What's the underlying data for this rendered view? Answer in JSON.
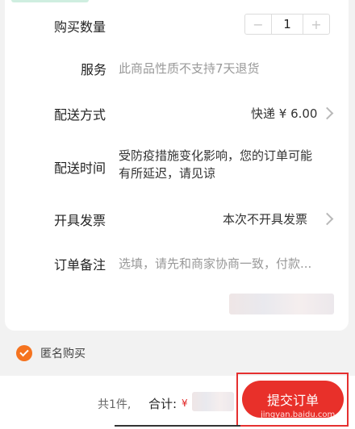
{
  "order": {
    "quantity": {
      "label": "购买数量",
      "value": "1",
      "minus": "−",
      "plus": "+"
    },
    "service": {
      "label": "服务",
      "value": "此商品性质不支持7天退货"
    },
    "delivery": {
      "label": "配送方式",
      "value": "快递 ¥ 6.00"
    },
    "delivery_time": {
      "label": "配送时间",
      "line1": "受防疫措施变化影响，您的订单可能",
      "line2": "有所延迟，请见谅"
    },
    "invoice": {
      "label": "开具发票",
      "value": "本次不开具发票"
    },
    "remark": {
      "label": "订单备注",
      "placeholder": "选填，请先和商家协商一致，付款..."
    }
  },
  "anonymous": {
    "label": "匿名购买",
    "checked": true
  },
  "footer": {
    "count": "共1件,",
    "total_label": "合计:",
    "currency": "¥",
    "submit": "提交订单",
    "watermark": "jingyan.baidu.com"
  },
  "colors": {
    "accent": "#f5731f",
    "submit": "#e8302a",
    "highlight": "#e53030"
  }
}
